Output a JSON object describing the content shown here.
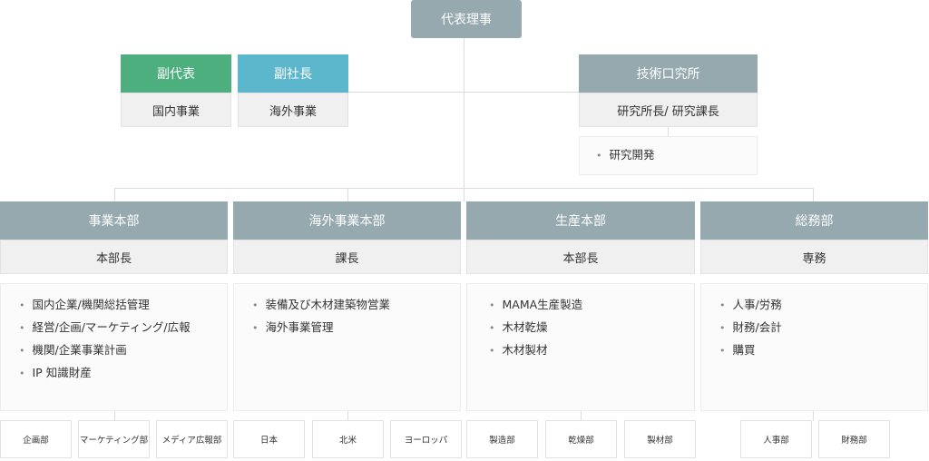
{
  "top": {
    "label": "代表理事"
  },
  "exec": [
    {
      "title": "副代表",
      "sub": "国内事業",
      "color": "#4caf7d"
    },
    {
      "title": "副社長",
      "sub": "海外事業",
      "color": "#5cb7cc"
    }
  ],
  "lab": {
    "title": "技術口究所",
    "sub": "研究所長/ 研究課長",
    "items": [
      "研究開発"
    ]
  },
  "divisions": [
    {
      "title": "事業本部",
      "sub": "本部長",
      "items": [
        "国内企業/機関総括管理",
        "経営/企画/マーケティング/広報",
        "機関/企業事業計画",
        "IP 知識財産"
      ],
      "leaves": [
        "企画部",
        "マーケティング部",
        "メディア広報部"
      ]
    },
    {
      "title": "海外事業本部",
      "sub": "課長",
      "items": [
        "装備及び木材建築物営業",
        "海外事業管理"
      ],
      "leaves": [
        "日本",
        "北米",
        "ヨーロッパ"
      ]
    },
    {
      "title": "生産本部",
      "sub": "本部長",
      "items": [
        "MAMA生産製造",
        "木材乾燥",
        "木材製材"
      ],
      "leaves": [
        "製造部",
        "乾燥部",
        "製材部"
      ]
    },
    {
      "title": "総務部",
      "sub": "専務",
      "items": [
        "人事/労務",
        "財務/会計",
        "購買"
      ],
      "leaves": [
        "人事部",
        "財務部"
      ]
    }
  ],
  "colors": {
    "header_gray": "#95a9af",
    "green": "#4caf7d",
    "blue": "#5cb7cc",
    "line": "#dcdcdc"
  }
}
